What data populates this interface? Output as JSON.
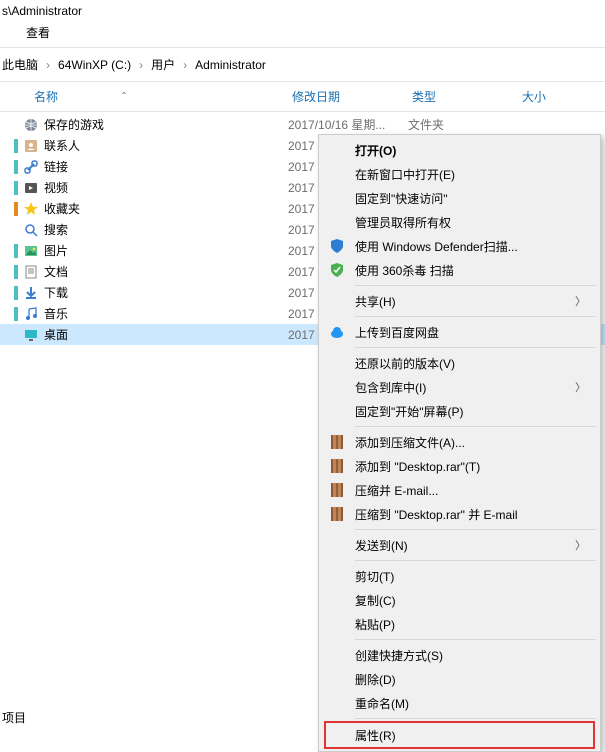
{
  "title_prefix": "s\\Administrator",
  "menubar": {
    "view": "查看"
  },
  "breadcrumbs": {
    "sep": "›",
    "items": [
      "此电脑",
      "64WinXP  (C:)",
      "用户",
      "Administrator"
    ]
  },
  "columns": {
    "name": "名称",
    "date": "修改日期",
    "type": "类型",
    "size": "大小"
  },
  "rows": [
    {
      "icon": "globe",
      "label": "保存的游戏",
      "date": "2017/10/16 星期...",
      "type": "文件夹"
    },
    {
      "icon": "contacts",
      "label": "联系人",
      "date": "2017",
      "marker": "teal"
    },
    {
      "icon": "link",
      "label": "链接",
      "date": "2017",
      "marker": "teal"
    },
    {
      "icon": "video",
      "label": "视频",
      "date": "2017",
      "marker": "teal"
    },
    {
      "icon": "star",
      "label": "收藏夹",
      "date": "2017",
      "marker": "orange"
    },
    {
      "icon": "search",
      "label": "搜索",
      "date": "2017"
    },
    {
      "icon": "pictures",
      "label": "图片",
      "date": "2017",
      "marker": "teal"
    },
    {
      "icon": "docs",
      "label": "文档",
      "date": "2017",
      "marker": "teal"
    },
    {
      "icon": "download",
      "label": "下载",
      "date": "2017",
      "marker": "teal"
    },
    {
      "icon": "music",
      "label": "音乐",
      "date": "2017",
      "marker": "teal"
    },
    {
      "icon": "desktop",
      "label": "桌面",
      "date": "2017",
      "selected": true
    }
  ],
  "ctx": {
    "open": "打开(O)",
    "open_new": "在新窗口中打开(E)",
    "pin_quick": "固定到\"快速访问\"",
    "admin_own": "管理员取得所有权",
    "defender": "使用 Windows Defender扫描...",
    "av360": "使用 360杀毒 扫描",
    "share": "共享(H)",
    "baidu": "上传到百度网盘",
    "restore": "还原以前的版本(V)",
    "library": "包含到库中(I)",
    "pin_start": "固定到\"开始\"屏幕(P)",
    "addarch": "添加到压缩文件(A)...",
    "addrar": "添加到 \"Desktop.rar\"(T)",
    "zipemail": "压缩并 E-mail...",
    "zipraremail": "压缩到 \"Desktop.rar\" 并 E-mail",
    "sendto": "发送到(N)",
    "cut": "剪切(T)",
    "copy": "复制(C)",
    "paste": "粘贴(P)",
    "shortcut": "创建快捷方式(S)",
    "delete": "删除(D)",
    "rename": "重命名(M)",
    "properties": "属性(R)"
  },
  "footer": "项目"
}
